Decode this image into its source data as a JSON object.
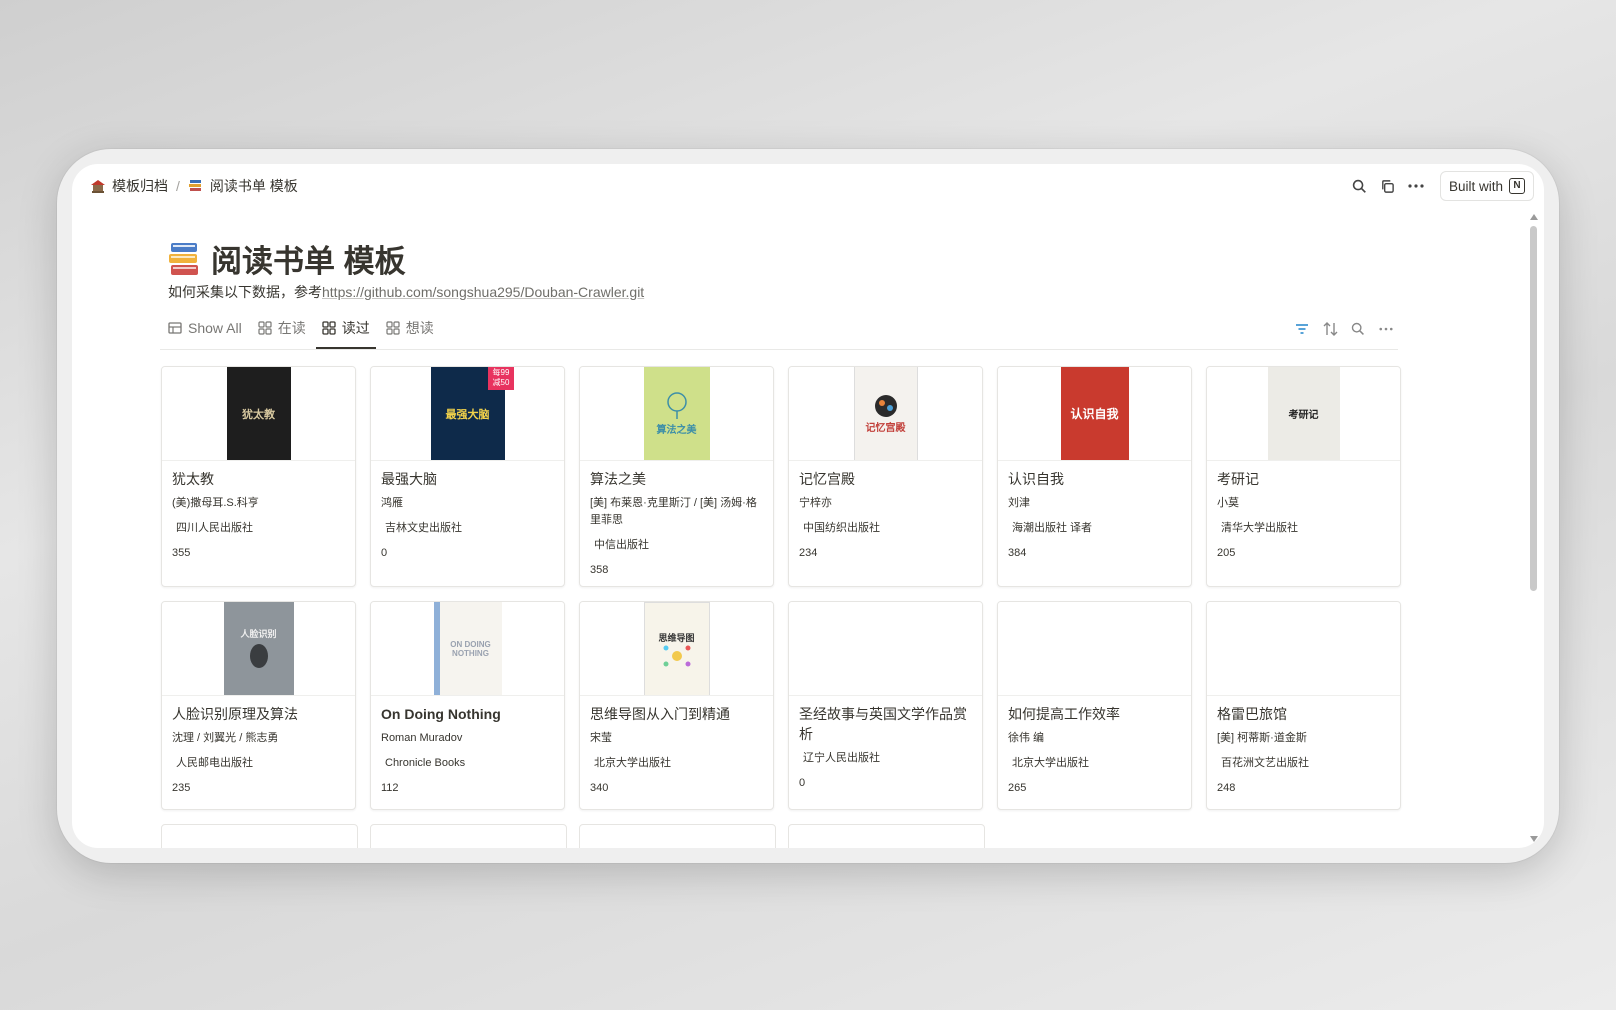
{
  "breadcrumb": {
    "parent": "模板归档",
    "current": "阅读书单 模板"
  },
  "top_actions": {
    "built_with": "Built with"
  },
  "page": {
    "title": "阅读书单 模板",
    "desc_prefix": "如何采集以下数据，参考",
    "desc_link": "https://github.com/songshua295/Douban-Crawler.git"
  },
  "tabs": [
    {
      "label": "Show All",
      "icon": "table-icon"
    },
    {
      "label": "在读",
      "icon": "gallery-icon"
    },
    {
      "label": "读过",
      "icon": "gallery-icon",
      "active": true
    },
    {
      "label": "想读",
      "icon": "gallery-icon"
    }
  ],
  "cards": [
    {
      "title": "犹太教",
      "author": "(美)撒母耳.S.科亨",
      "publisher": "四川人民出版社",
      "pages": "355",
      "cover_text": "犹太教",
      "cover_bg": "#1e1e1e",
      "cover_fg": "#d8c9a0"
    },
    {
      "title": "最强大脑",
      "author": "鸿雁",
      "publisher": "吉林文史出版社",
      "pages": "0",
      "cover_text": "最强大脑",
      "cover_badge": "每99 减50",
      "cover_bg": "#0e2a4a",
      "cover_fg": "#f2d24a"
    },
    {
      "title": "算法之美",
      "author": "[美] 布莱恩·克里斯汀 / [美] 汤姆·格里菲思",
      "publisher": "中信出版社",
      "pages": "358",
      "cover_text": "算法之美",
      "cover_bg": "#cfe08a",
      "cover_fg": "#3d8fa8"
    },
    {
      "title": "记忆宫殿",
      "author": "宁梓亦",
      "publisher": "中国纺织出版社",
      "pages": "234",
      "cover_text": "记忆宫殿",
      "cover_bg": "#f4f2ee",
      "cover_fg": "#c2403a"
    },
    {
      "title": "认识自我",
      "author": "刘津",
      "publisher": "海潮出版社 译者",
      "pages": "384",
      "cover_text": "认识自我",
      "cover_bg": "#c93a2e",
      "cover_fg": "#ffffff"
    },
    {
      "title": "考研记",
      "author": "小莫",
      "publisher": "清华大学出版社",
      "pages": "205",
      "cover_text": "考研记",
      "cover_bg": "#ecebe6",
      "cover_fg": "#222222"
    },
    {
      "title": "人脸识别原理及算法",
      "author": "沈理 / 刘翼光 / 熊志勇",
      "publisher": "人民邮电出版社",
      "pages": "235",
      "cover_text": "人脸识别",
      "cover_bg": "#8e959b",
      "cover_fg": "#f0f0f0"
    },
    {
      "title": "On Doing Nothing",
      "author": "Roman Muradov",
      "publisher": "Chronicle Books",
      "pages": "112",
      "cover_text": "ON DOING NOTHING",
      "cover_bg": "#f6f4ef",
      "cover_fg": "#9aa2b0"
    },
    {
      "title": "思维导图从入门到精通",
      "author": "宋莹",
      "publisher": "北京大学出版社",
      "pages": "340",
      "cover_text": "思维导图",
      "cover_bg": "#f7f4ea",
      "cover_fg": "#333333"
    },
    {
      "title": "圣经故事与英国文学作品赏析",
      "author": "",
      "publisher": "辽宁人民出版社",
      "pages": "0"
    },
    {
      "title": "如何提高工作效率",
      "author": "徐伟 编",
      "publisher": "北京大学出版社",
      "pages": "265"
    },
    {
      "title": "格雷巴旅馆",
      "author": "[美] 柯蒂斯·道金斯",
      "publisher": "百花洲文艺出版社",
      "pages": "248"
    }
  ]
}
